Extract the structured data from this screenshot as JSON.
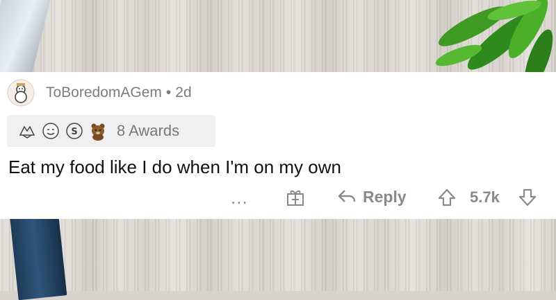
{
  "comment": {
    "username": "ToBoredomAGem",
    "separator": "•",
    "age": "2d",
    "awards": {
      "icons": [
        "hands-clasped-award-icon",
        "face-award-icon",
        "silver-coin-award-icon",
        "bear-award-icon"
      ],
      "count_label": "8 Awards"
    },
    "body": "Eat my food like I do when I'm on my own",
    "actions": {
      "more_label": "...",
      "gift_icon": "gift-icon",
      "reply_label": "Reply",
      "upvote_icon": "upvote-arrow-icon",
      "score": "5.7k",
      "downvote_icon": "downvote-arrow-icon"
    }
  },
  "colors": {
    "card_bg": "#ffffff",
    "meta_text": "#7c7c7c",
    "action_gray": "#878a8c",
    "body_text": "#111111",
    "awards_bg": "#f0f0f0"
  }
}
